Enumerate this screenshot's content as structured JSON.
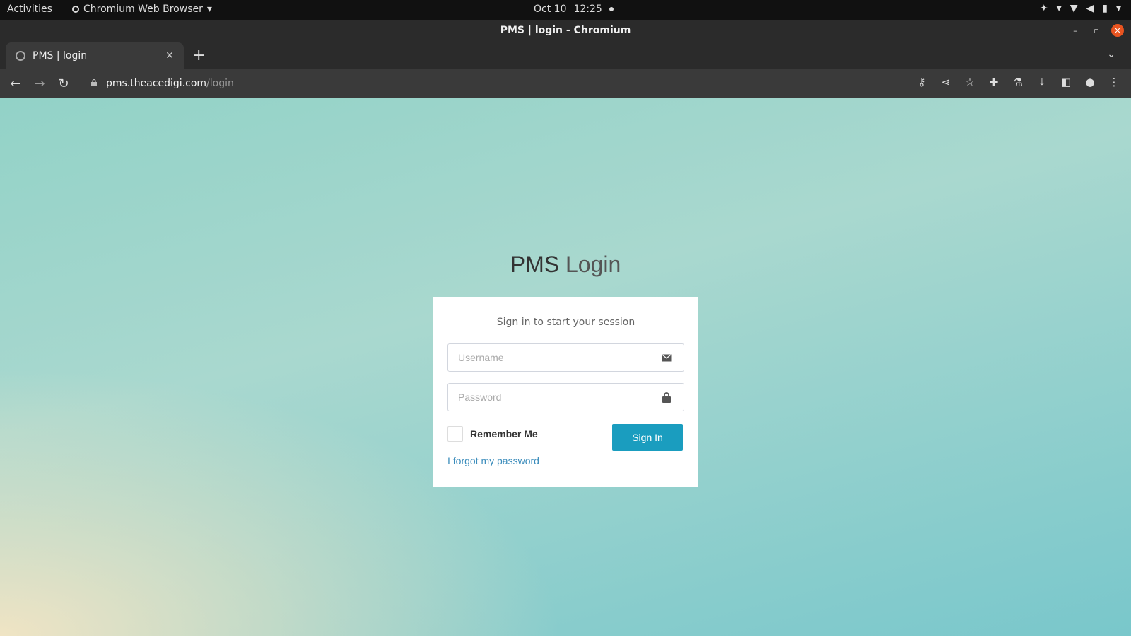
{
  "os_bar": {
    "activities": "Activities",
    "app_menu": "Chromium Web Browser",
    "date": "Oct 10",
    "time": "12:25"
  },
  "window": {
    "title": "PMS | login - Chromium"
  },
  "tabs": [
    {
      "label": "PMS | login",
      "active": true
    }
  ],
  "address_bar": {
    "host": "pms.theacedigi.com",
    "path": "/login"
  },
  "page": {
    "title_bold": "PMS",
    "title_light": "Login",
    "box_message": "Sign in to start your session",
    "username_placeholder": "Username",
    "password_placeholder": "Password",
    "remember_label": "Remember Me",
    "signin_label": "Sign In",
    "forgot_link": "I forgot my password"
  },
  "colors": {
    "signin_button": "#1a9dbf",
    "link": "#3c8dbc",
    "os_close": "#e95420"
  }
}
